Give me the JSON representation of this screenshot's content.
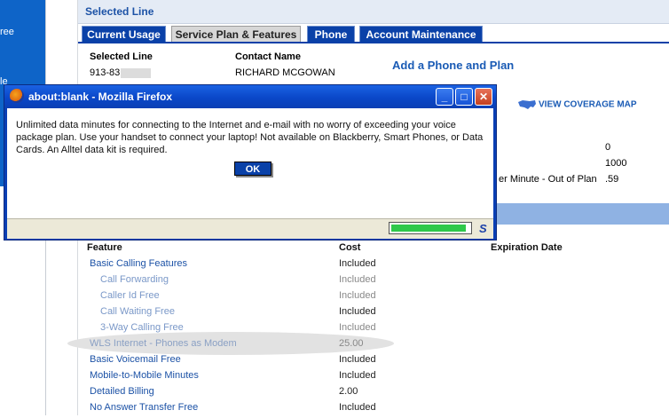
{
  "sidebar": {
    "fragment_1": "ree",
    "fragment_2": "le"
  },
  "header": {
    "title": "Selected Line"
  },
  "tabs": [
    {
      "label": "Current Usage",
      "active": false
    },
    {
      "label": "Service Plan & Features",
      "active": true
    },
    {
      "label": "Phone",
      "active": false
    },
    {
      "label": "Account Maintenance",
      "active": false
    }
  ],
  "line_info": {
    "selected_line_label": "Selected Line",
    "selected_line_value": "913-83",
    "contact_name_label": "Contact Name",
    "contact_name_value": "RICHARD MCGOWAN",
    "add_phone_link": "Add a Phone and Plan"
  },
  "coverage": {
    "link": "VIEW COVERAGE MAP"
  },
  "usage_values": {
    "v1": "0",
    "v2": "1000",
    "rate_label": "er Minute - Out of Plan",
    "rate_value": ".59"
  },
  "features": {
    "headers": {
      "feature": "Feature",
      "cost": "Cost",
      "expiration": "Expiration Date"
    },
    "rows": [
      {
        "name": "Basic Calling Features",
        "cost": "Included",
        "style": "main"
      },
      {
        "name": "Call Forwarding",
        "cost": "Included",
        "style": "sub"
      },
      {
        "name": "Caller Id Free",
        "cost": "Included",
        "style": "sub"
      },
      {
        "name": "Call Waiting Free",
        "cost": "Included",
        "style": "sub"
      },
      {
        "name": "3-Way Calling Free",
        "cost": "Included",
        "style": "sub"
      },
      {
        "name": "WLS Internet - Phones as Modem",
        "cost": "25.00",
        "style": "dim"
      },
      {
        "name": "Basic Voicemail Free",
        "cost": "Included",
        "style": "main"
      },
      {
        "name": "Mobile-to-Mobile Minutes",
        "cost": "Included",
        "style": "main"
      },
      {
        "name": "Detailed Billing",
        "cost": "2.00",
        "style": "main"
      },
      {
        "name": "No Answer Transfer Free",
        "cost": "Included",
        "style": "main"
      }
    ]
  },
  "dialog": {
    "title": "about:blank - Mozilla Firefox",
    "message": "Unlimited data minutes for connecting to the Internet and e-mail with no worry of exceeding your voice package plan. Use your handset to connect your laptop! Not available on Blackberry, Smart Phones, or Data Cards. An Alltel data kit is required.",
    "ok_label": "OK",
    "progress_fraction": 0.95,
    "minimize_glyph": "_",
    "maximize_glyph": "□",
    "close_glyph": "✕",
    "status_glyph": "S"
  },
  "colors": {
    "brand_blue": "#0a41a8",
    "link_blue": "#1c52a6",
    "progress_green": "#2fc84a"
  }
}
